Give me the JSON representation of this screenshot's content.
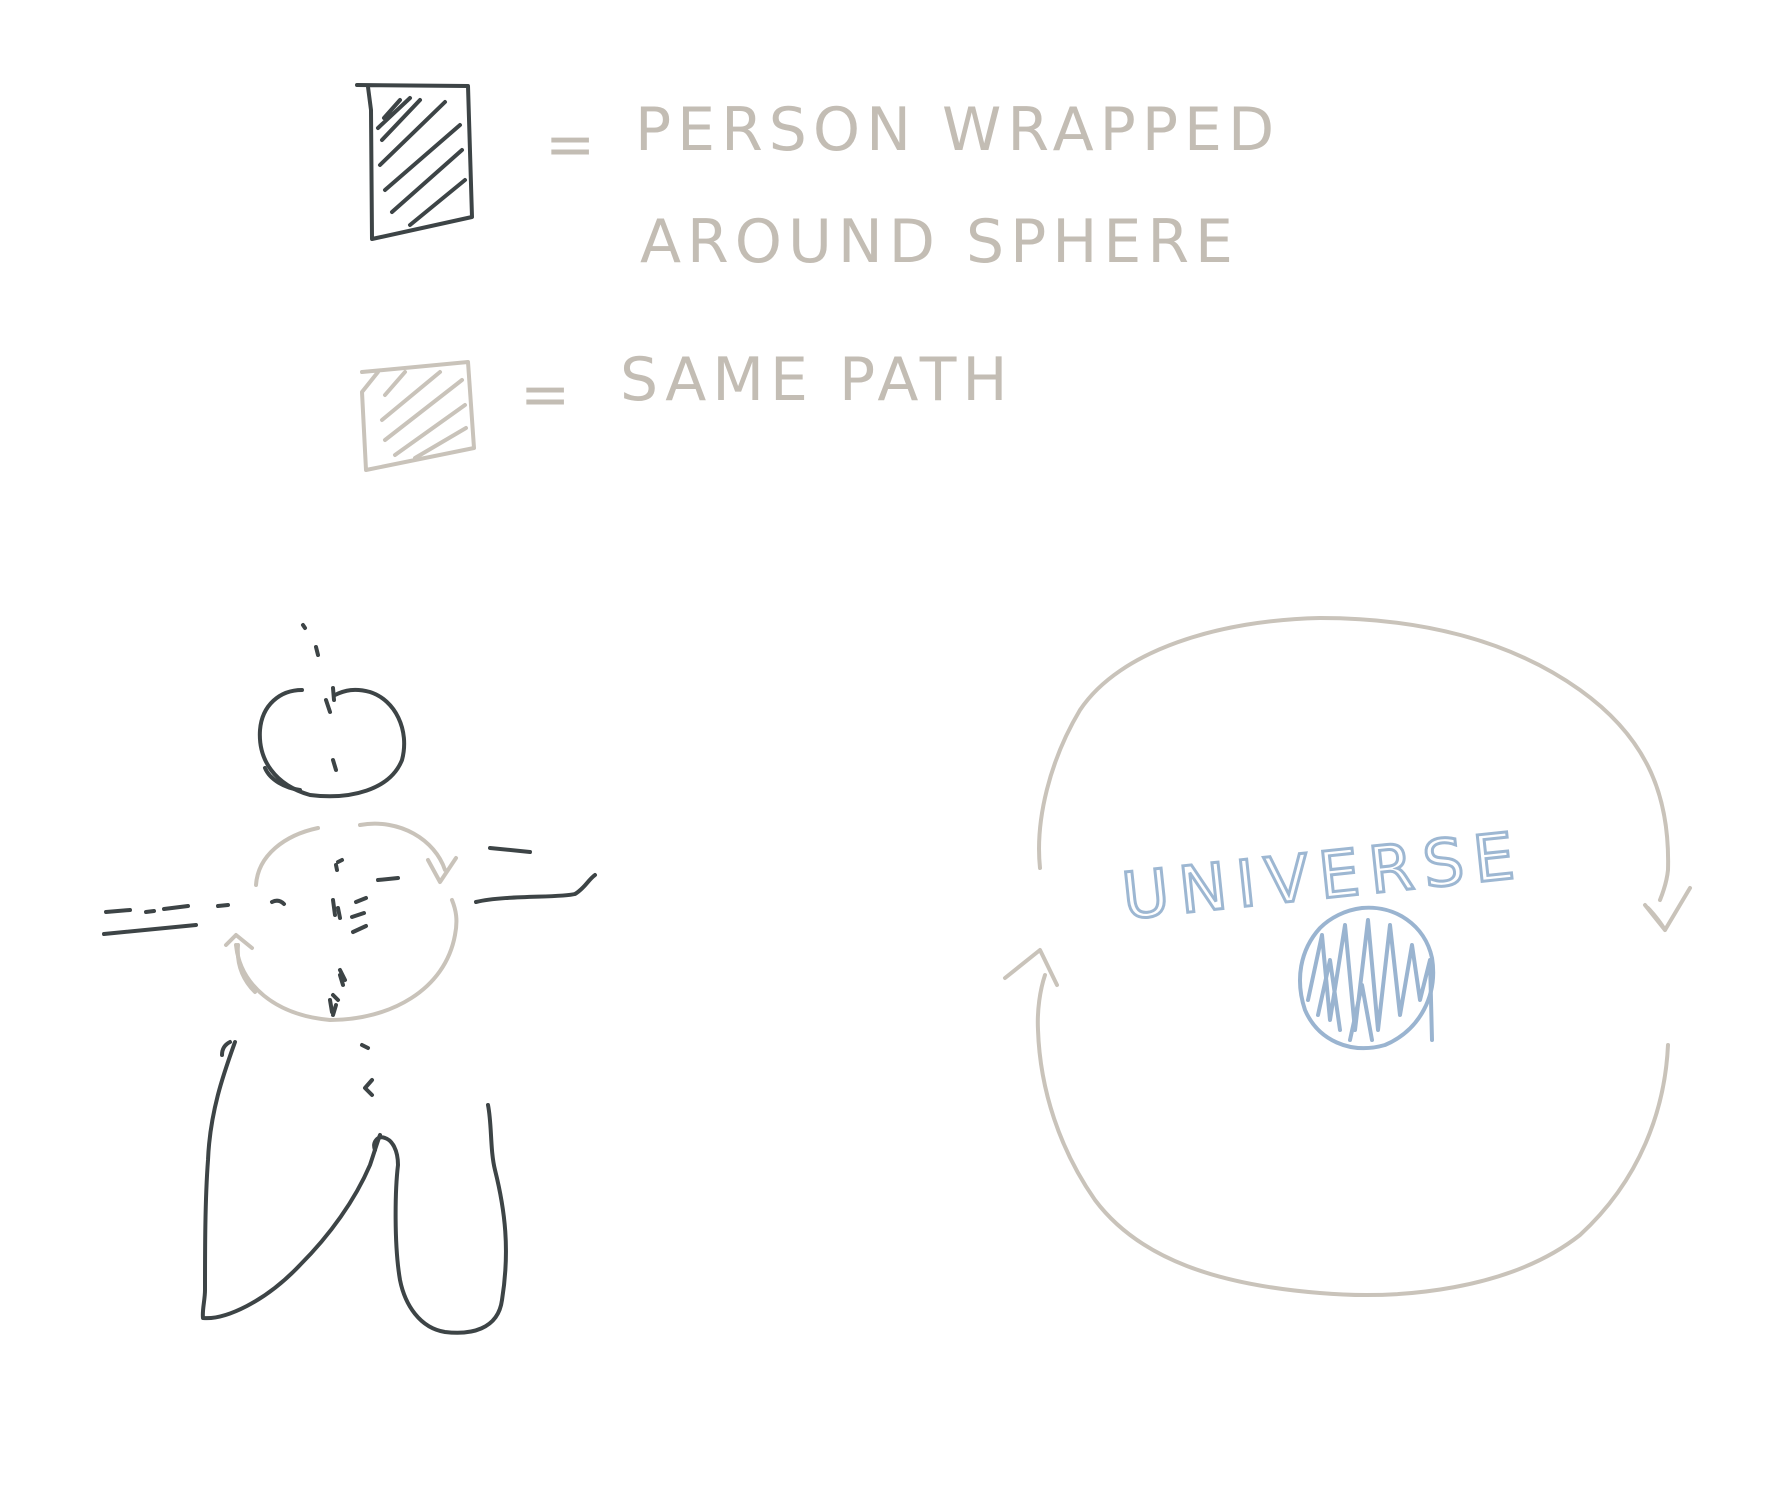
{
  "legend": {
    "items": [
      {
        "symbol": "dark-hatched-box",
        "equals": "=",
        "label_line1": "PERSON WRAPPED",
        "label_line2": "AROUND SPHERE"
      },
      {
        "symbol": "light-hatched-box",
        "equals": "=",
        "label_line1": "SAME PATH",
        "label_line2": ""
      }
    ]
  },
  "universe_diagram": {
    "label": "UNIVERSE"
  },
  "colors": {
    "person_ink": "#3d4446",
    "path_grey": "#c9c3ba",
    "legend_text": "#c3bdb4",
    "universe_blue": "#9ab4d0"
  }
}
